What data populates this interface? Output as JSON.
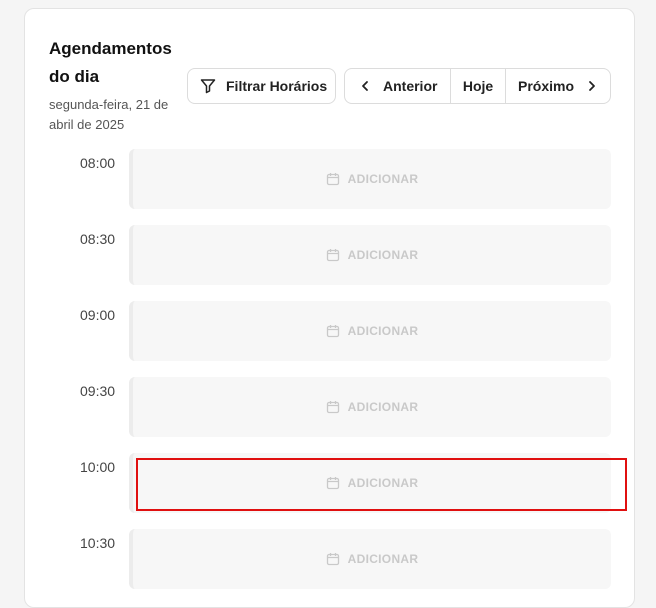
{
  "header": {
    "title": "Agendamentos do dia",
    "date": "segunda-feira, 21 de abril de 2025"
  },
  "toolbar": {
    "filter_label": "Filtrar Horários",
    "prev_label": "Anterior",
    "today_label": "Hoje",
    "next_label": "Próximo"
  },
  "slots": [
    {
      "time": "08:00",
      "action": "ADICIONAR"
    },
    {
      "time": "08:30",
      "action": "ADICIONAR"
    },
    {
      "time": "09:00",
      "action": "ADICIONAR"
    },
    {
      "time": "09:30",
      "action": "ADICIONAR"
    },
    {
      "time": "10:00",
      "action": "ADICIONAR"
    },
    {
      "time": "10:30",
      "action": "ADICIONAR"
    }
  ],
  "colors": {
    "highlight": "#e01010",
    "slot_background": "#f7f7f7",
    "muted_text": "#c9c9c9"
  },
  "icons": [
    "filter-icon",
    "chevron-left-icon",
    "chevron-right-icon",
    "calendar-icon"
  ]
}
